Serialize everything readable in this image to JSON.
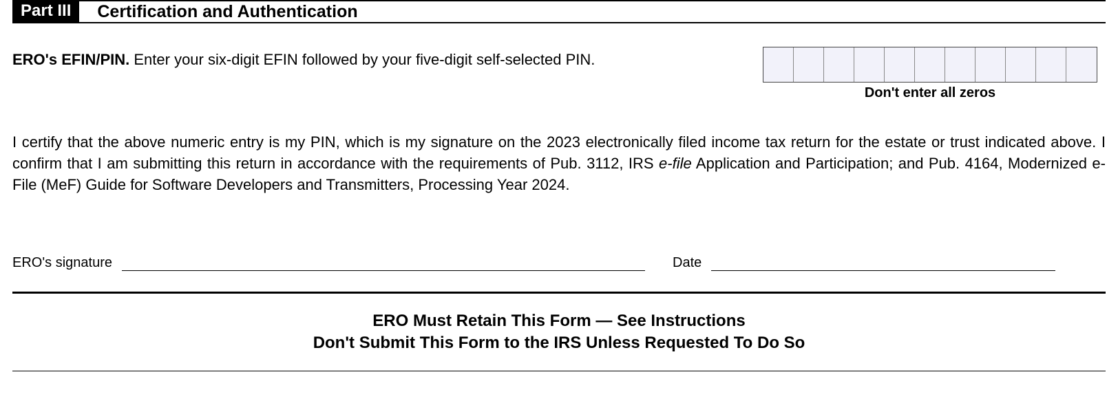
{
  "header": {
    "part_label": "Part III",
    "part_title": "Certification and Authentication"
  },
  "efin": {
    "label": "ERO's EFIN/PIN.",
    "instruction": " Enter your six-digit EFIN followed by your five-digit self-selected PIN.",
    "box_count": 11,
    "caption": "Don't enter all zeros"
  },
  "certification": {
    "text_before_italic": "I certify that the above numeric entry is my PIN, which is my signature on the 2023 electronically filed income tax return for the estate or trust indicated above. I confirm that I am submitting this return in accordance with the requirements of Pub. 3112, IRS ",
    "italic_text": "e-file",
    "text_after_italic": " Application and Participation; and Pub. 4164, Modernized e-File (MeF) Guide for Software Developers and Transmitters, Processing Year 2024."
  },
  "signature": {
    "sig_label": "ERO's signature",
    "date_label": "Date"
  },
  "footer": {
    "line1": "ERO Must Retain This Form — See Instructions",
    "line2": "Don't Submit This Form to the IRS Unless Requested To Do So"
  }
}
